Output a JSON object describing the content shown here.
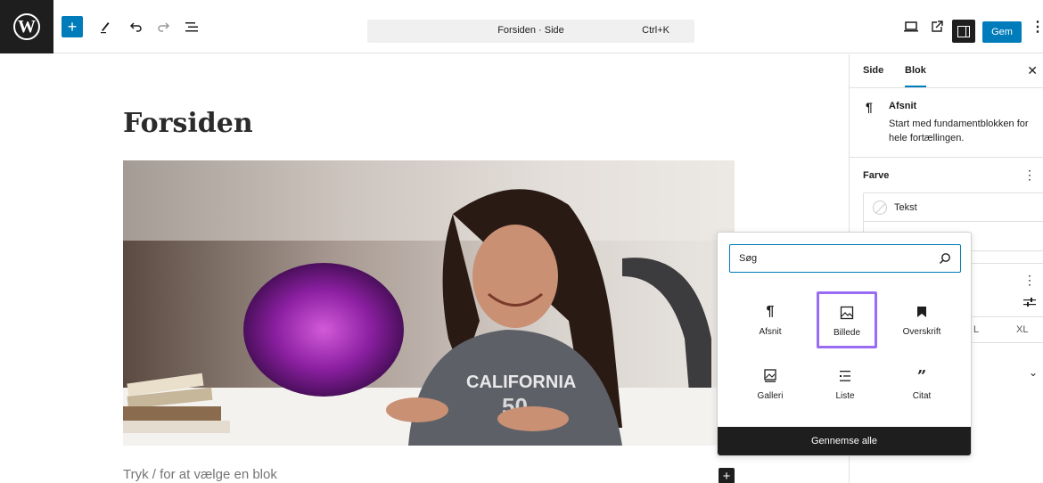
{
  "toolbar": {
    "logo_glyph": "W",
    "add_icon": "plus-icon",
    "tools_icon": "pencil-icon",
    "undo_icon": "undo-icon",
    "redo_icon": "redo-icon",
    "list_view_icon": "list-view-icon",
    "document_title": "Forsiden · Side",
    "shortcut": "Ctrl+K",
    "view_icon": "desktop-view-icon",
    "external_icon": "external-link-icon",
    "sidebar_icon": "sidebar-toggle-icon",
    "save_label": "Gem",
    "options_icon": "more-options-icon"
  },
  "editor": {
    "page_title": "Forsiden",
    "placeholder": "Tryk / for at vælge en blok"
  },
  "sidebar": {
    "tabs": [
      "Side",
      "Blok"
    ],
    "active_tab": "Blok",
    "block_card": {
      "icon": "¶",
      "title": "Afsnit",
      "description": "Start med fundamentblokken for hele fortællingen."
    },
    "color_section": {
      "title": "Farve",
      "items": [
        "Tekst"
      ]
    },
    "size_options": [
      "L",
      "XL"
    ]
  },
  "inserter": {
    "search_placeholder": "Søg",
    "blocks": [
      {
        "label": "Afsnit",
        "icon": "paragraph-icon"
      },
      {
        "label": "Billede",
        "icon": "image-icon"
      },
      {
        "label": "Overskrift",
        "icon": "heading-icon"
      },
      {
        "label": "Galleri",
        "icon": "gallery-icon"
      },
      {
        "label": "Liste",
        "icon": "list-icon"
      },
      {
        "label": "Citat",
        "icon": "quote-icon"
      }
    ],
    "highlighted": "Billede",
    "footer_label": "Gennemse alle"
  },
  "colors": {
    "accent": "#007cba",
    "highlight": "#9a6cf6",
    "dark": "#1e1e1e"
  }
}
